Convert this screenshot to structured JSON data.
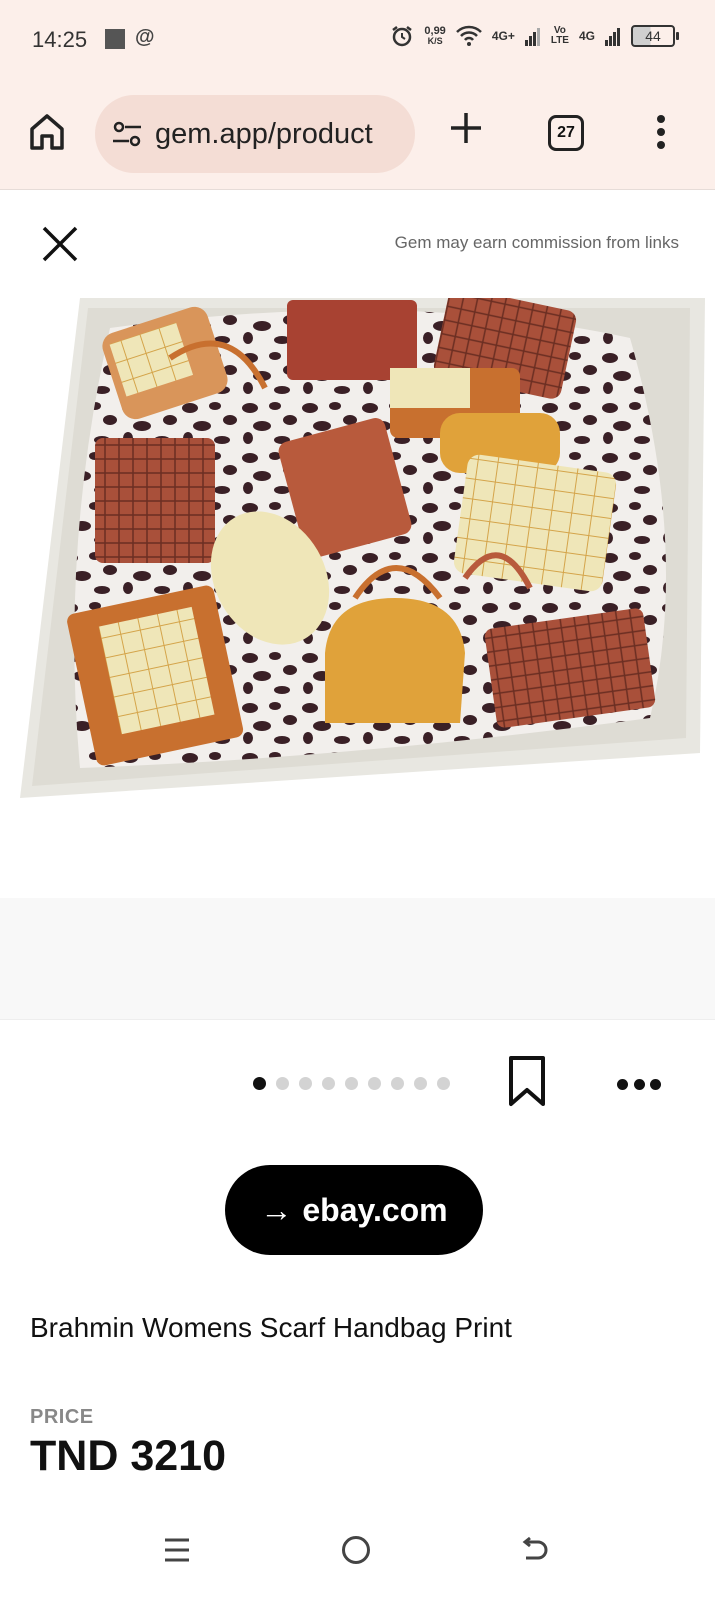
{
  "status_bar": {
    "time": "14:25",
    "net_speed_value": "0,99",
    "net_speed_unit": "K/S",
    "signal1_label": "4G+",
    "volte_top": "Vo",
    "volte_bottom": "LTE",
    "signal2_label": "4G",
    "battery": "44"
  },
  "browser": {
    "url": "gem.app/product",
    "tab_count": "27"
  },
  "header": {
    "commission_note": "Gem may earn commission from links"
  },
  "carousel": {
    "dot_count": 9,
    "active_index": 0
  },
  "cta": {
    "arrow": "→",
    "label": "ebay.com"
  },
  "product": {
    "title": "Brahmin Womens Scarf Handbag Print",
    "price_label": "PRICE",
    "price": "TND 3210"
  },
  "colors": {
    "toolbar_bg": "#fcefea",
    "url_pill_bg": "#f4ddd5",
    "cta_bg": "#000000",
    "rust": "#b85a3c",
    "mustard": "#e0a23a",
    "cream": "#efe6b8",
    "leopard": "#3a2026"
  }
}
